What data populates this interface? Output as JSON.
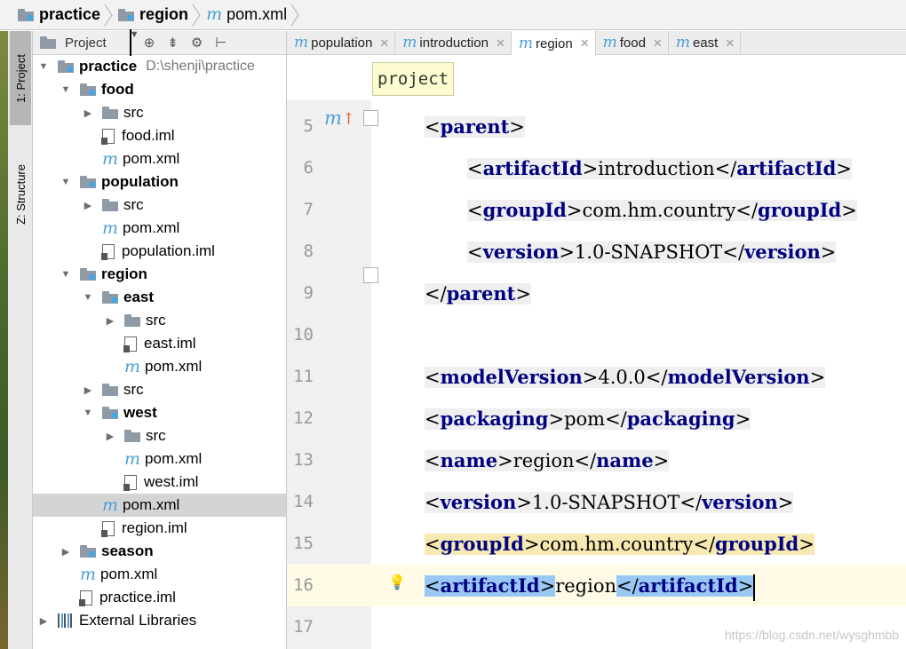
{
  "breadcrumb": {
    "items": [
      "practice",
      "region",
      "pom.xml"
    ]
  },
  "toolwindows": {
    "project_tab": "1: Project",
    "structure_tab": "Z: Structure"
  },
  "project_panel": {
    "title": "Project",
    "tree": [
      {
        "label": "practice",
        "path": "D:\\shenji\\practice",
        "bold": true,
        "type": "module",
        "expanded": true
      },
      {
        "label": "food",
        "bold": true,
        "type": "module",
        "expanded": true
      },
      {
        "label": "src",
        "type": "folder",
        "expanded": false
      },
      {
        "label": "food.iml",
        "type": "iml"
      },
      {
        "label": "pom.xml",
        "type": "pom"
      },
      {
        "label": "population",
        "bold": true,
        "type": "module",
        "expanded": true
      },
      {
        "label": "src",
        "type": "folder",
        "expanded": false
      },
      {
        "label": "pom.xml",
        "type": "pom"
      },
      {
        "label": "population.iml",
        "type": "iml"
      },
      {
        "label": "region",
        "bold": true,
        "type": "module",
        "expanded": true
      },
      {
        "label": "east",
        "bold": true,
        "type": "module",
        "expanded": true
      },
      {
        "label": "src",
        "type": "folder",
        "expanded": false
      },
      {
        "label": "east.iml",
        "type": "iml"
      },
      {
        "label": "pom.xml",
        "type": "pom"
      },
      {
        "label": "src",
        "type": "folder",
        "expanded": false
      },
      {
        "label": "west",
        "bold": true,
        "type": "module",
        "expanded": true
      },
      {
        "label": "src",
        "type": "folder",
        "expanded": false
      },
      {
        "label": "pom.xml",
        "type": "pom"
      },
      {
        "label": "west.iml",
        "type": "iml"
      },
      {
        "label": "pom.xml",
        "type": "pom",
        "selected": true
      },
      {
        "label": "region.iml",
        "type": "iml"
      },
      {
        "label": "season",
        "bold": true,
        "type": "module",
        "expanded": false
      },
      {
        "label": "pom.xml",
        "type": "pom"
      },
      {
        "label": "practice.iml",
        "type": "iml"
      },
      {
        "label": "External Libraries",
        "type": "libs",
        "expanded": false
      }
    ]
  },
  "editor_tabs": [
    {
      "label": "population",
      "active": false
    },
    {
      "label": "introduction",
      "active": false
    },
    {
      "label": "region",
      "active": true
    },
    {
      "label": "food",
      "active": false
    },
    {
      "label": "east",
      "active": false
    }
  ],
  "editor": {
    "breadcrumb_tooltip": "project",
    "lines": [
      {
        "num": "5",
        "tag": "parent",
        "close": false,
        "text": ""
      },
      {
        "num": "6",
        "tag": "artifactId",
        "text": "introduction"
      },
      {
        "num": "7",
        "tag": "groupId",
        "text": "com.hm.country"
      },
      {
        "num": "8",
        "tag": "version",
        "text": "1.0-SNAPSHOT"
      },
      {
        "num": "9",
        "tag": "parent",
        "close": true,
        "text": ""
      },
      {
        "num": "10",
        "tag": "",
        "text": ""
      },
      {
        "num": "11",
        "tag": "modelVersion",
        "text": "4.0.0"
      },
      {
        "num": "12",
        "tag": "packaging",
        "text": "pom"
      },
      {
        "num": "13",
        "tag": "name",
        "text": "region"
      },
      {
        "num": "14",
        "tag": "version",
        "text": "1.0-SNAPSHOT"
      },
      {
        "num": "15",
        "tag": "groupId",
        "text": "com.hm.country"
      },
      {
        "num": "16",
        "tag": "artifactId",
        "text": "region"
      },
      {
        "num": "17",
        "tag": "",
        "text": ""
      }
    ]
  },
  "watermark": "https://blog.csdn.net/wysghmbb"
}
